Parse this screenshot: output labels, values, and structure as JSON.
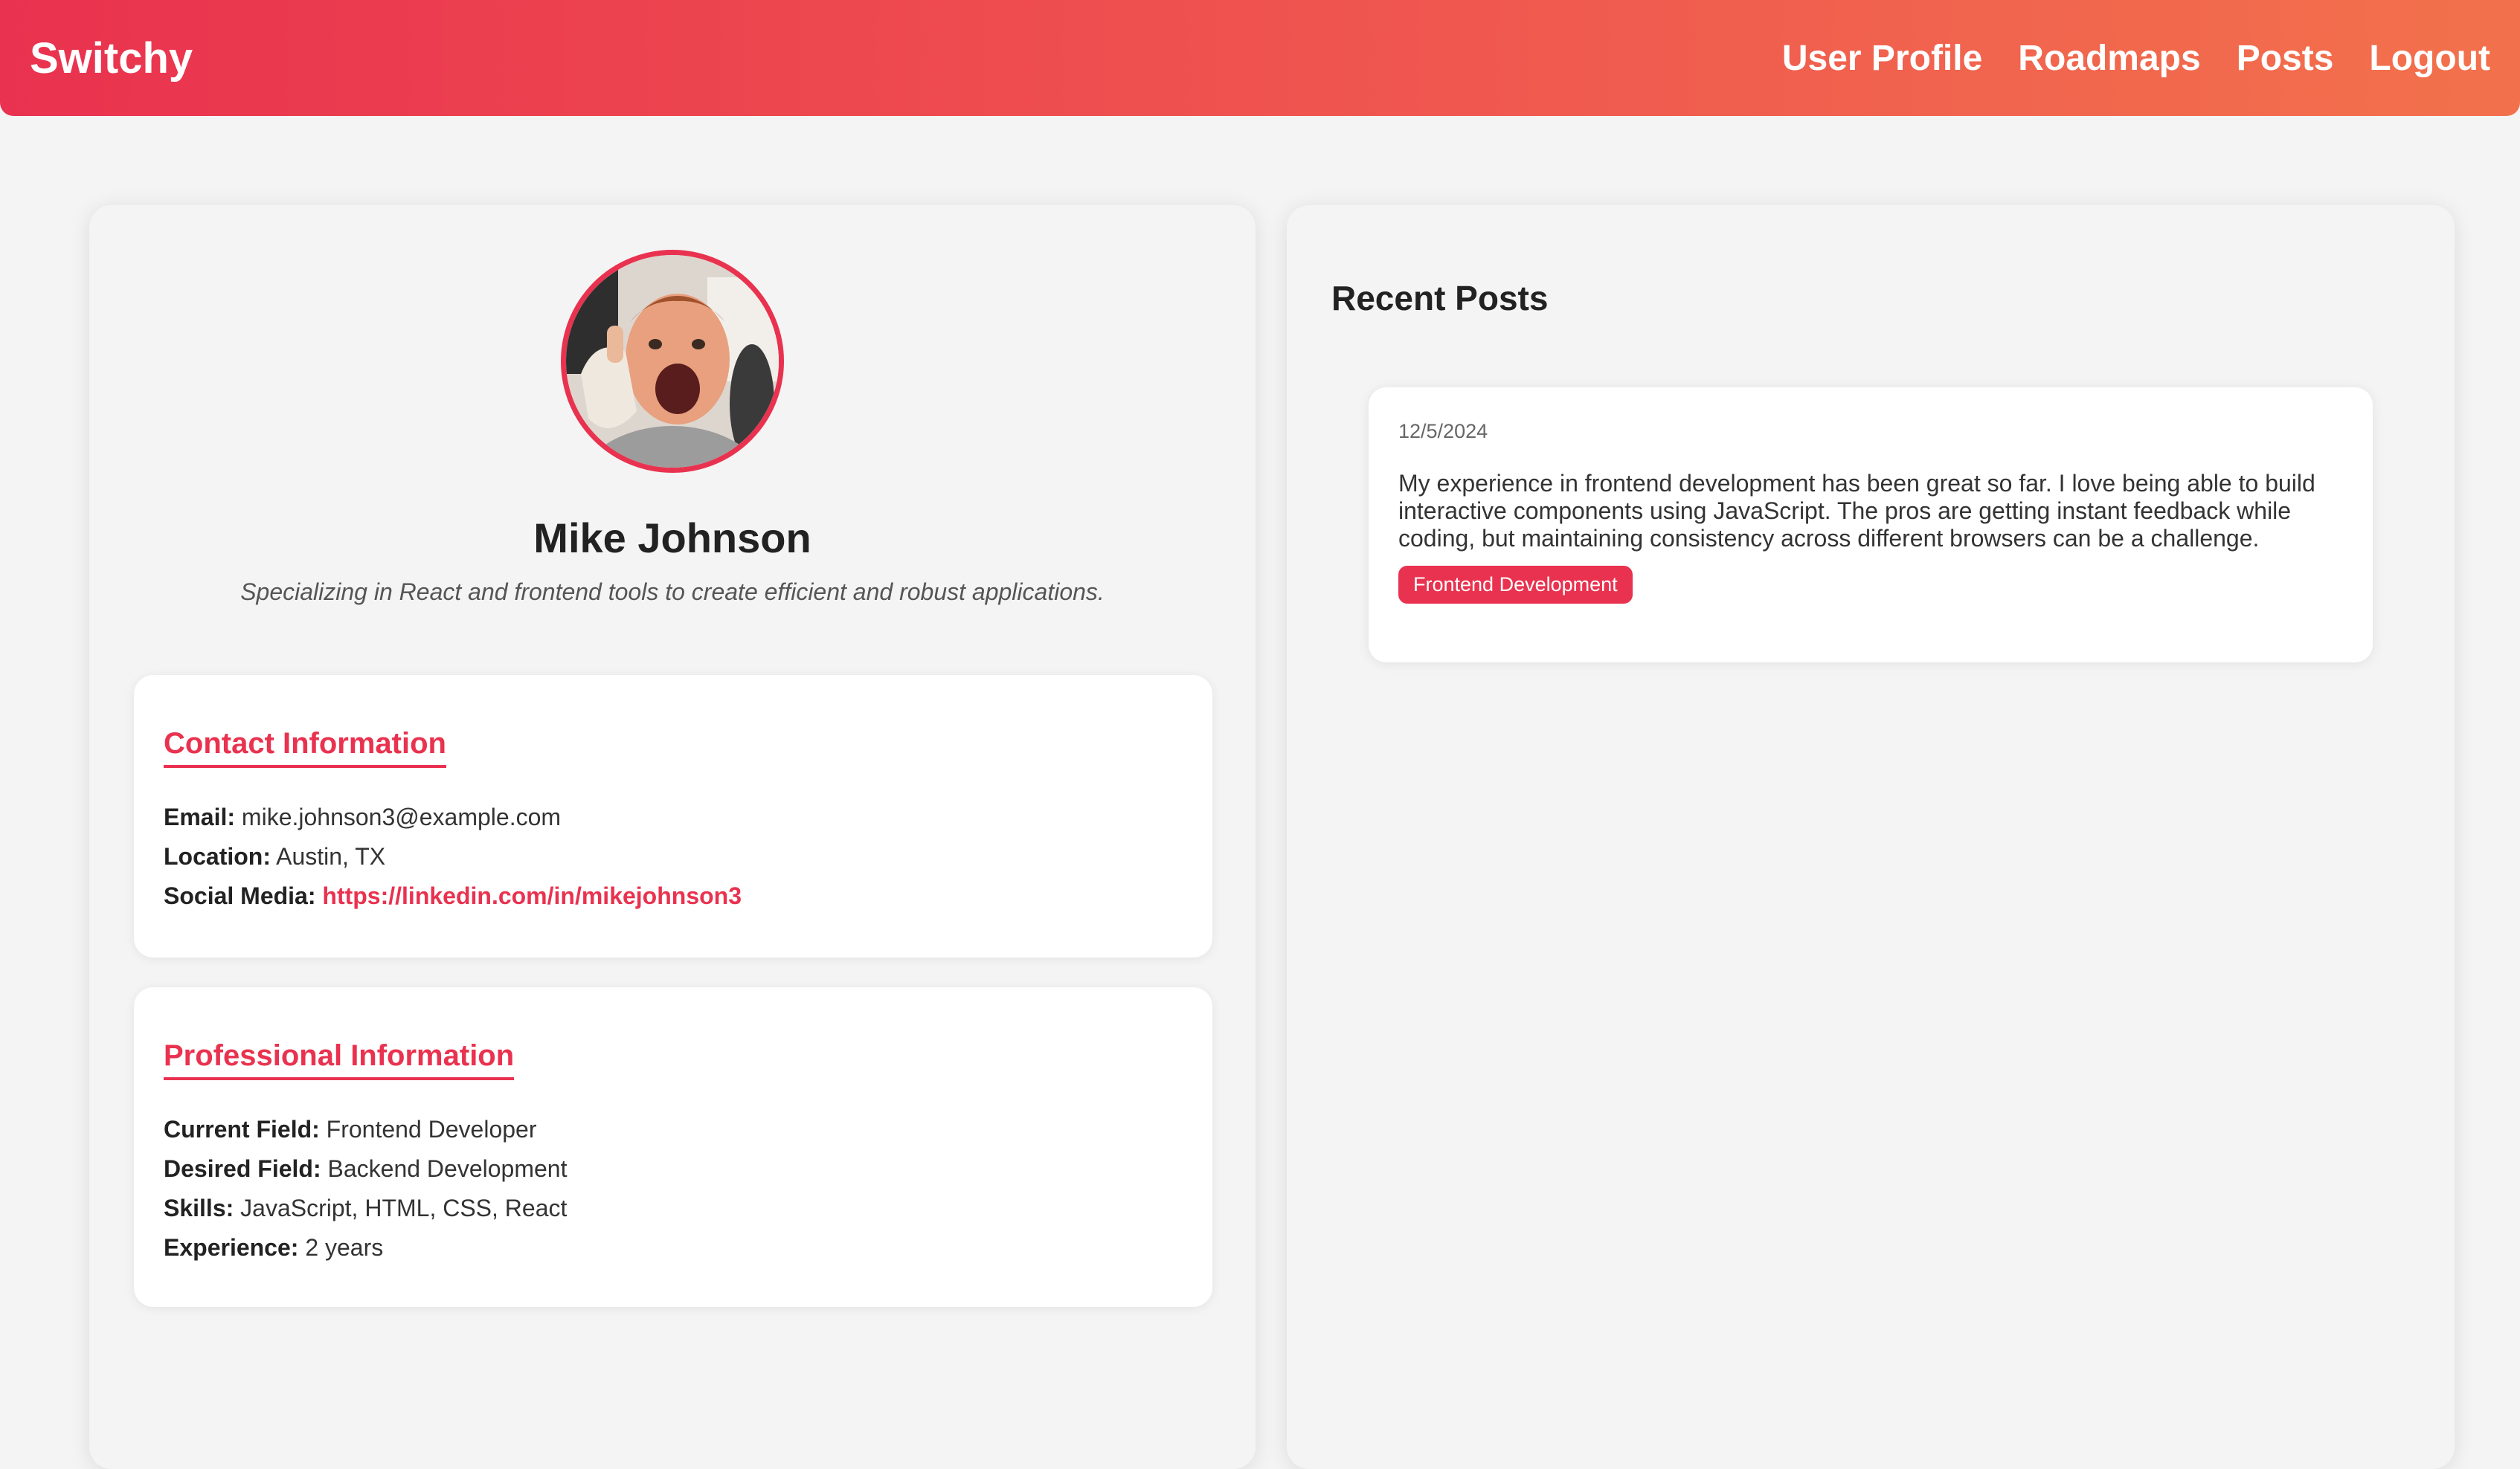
{
  "navbar": {
    "brand": "Switchy",
    "links": [
      "User Profile",
      "Roadmaps",
      "Posts",
      "Logout"
    ]
  },
  "profile": {
    "name": "Mike Johnson",
    "bio": "Specializing in React and frontend tools to create efficient and robust applications."
  },
  "contact": {
    "title": "Contact Information",
    "email_label": "Email:",
    "email": "mike.johnson3@example.com",
    "location_label": "Location:",
    "location": "Austin, TX",
    "social_label": "Social Media:",
    "social": "https://linkedin.com/in/mikejohnson3"
  },
  "professional": {
    "title": "Professional Information",
    "current_label": "Current Field:",
    "current": "Frontend Developer",
    "desired_label": "Desired Field:",
    "desired": "Backend Development",
    "skills_label": "Skills:",
    "skills": "JavaScript, HTML, CSS, React",
    "experience_label": "Experience:",
    "experience": "2 years"
  },
  "recent_posts": {
    "title": "Recent Posts",
    "posts": [
      {
        "date": "12/5/2024",
        "body": "My experience in frontend development has been great so far. I love being able to build interactive components using JavaScript. The pros are getting instant feedback while coding, but maintaining consistency across different browsers can be a challenge.",
        "tag": "Frontend Development"
      }
    ]
  },
  "colors": {
    "accent": "#e9324f",
    "gradient_end": "#f2714c"
  }
}
